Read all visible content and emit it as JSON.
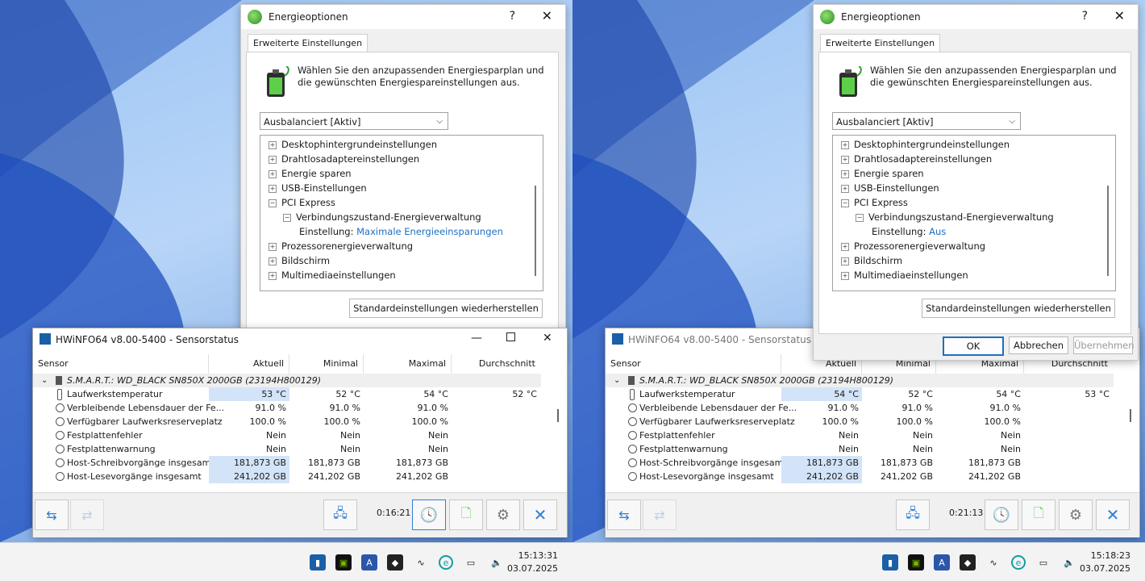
{
  "panels": [
    {
      "energy": {
        "title": "Energieoptionen",
        "help": "?",
        "close": "✕",
        "tab": "Erweiterte Einstellungen",
        "description": "Wählen Sie den anzupassenden Energiesparplan und die gewünschten Energiespareinstellungen aus.",
        "plan": "Ausbalanciert [Aktiv]",
        "tree": [
          "Desktophintergrundeinstellungen",
          "Drahtlosadaptereinstellungen",
          "Energie sparen",
          "USB-Einstellungen",
          "PCI Express",
          "Verbindungszustand-Energieverwaltung",
          "Einstellung:",
          "Prozessorenergieverwaltung",
          "Bildschirm",
          "Multimediaeinstellungen"
        ],
        "setting_value": "Maximale Energieeinsparungen",
        "restore": "Standardeinstellungen wiederherstellen",
        "ok": "",
        "cancel": "",
        "apply": ""
      },
      "hw": {
        "title": "HWiNFO64 v8.00-5400 - Sensorstatus",
        "columns": [
          "Sensor",
          "Aktuell",
          "Minimal",
          "Maximal",
          "Durchschnitt"
        ],
        "device": "S.M.A.R.T.: WD_BLACK SN850X 2000GB (23194H800129)",
        "rows": [
          [
            "Laufwerkstemperatur",
            "53 °C",
            "52 °C",
            "54 °C",
            "52 °C"
          ],
          [
            "Verbleibende Lebensdauer der Fe...",
            "91.0 %",
            "91.0 %",
            "91.0 %",
            ""
          ],
          [
            "Verfügbarer Laufwerksreserveplatz",
            "100.0 %",
            "100.0 %",
            "100.0 %",
            ""
          ],
          [
            "Festplattenfehler",
            "Nein",
            "Nein",
            "Nein",
            ""
          ],
          [
            "Festplattenwarnung",
            "Nein",
            "Nein",
            "Nein",
            ""
          ],
          [
            "Host-Schreibvorgänge insgesamt",
            "181,873 GB",
            "181,873 GB",
            "181,873 GB",
            ""
          ],
          [
            "Host-Lesevorgänge insgesamt",
            "241,202 GB",
            "241,202 GB",
            "241,202 GB",
            ""
          ]
        ],
        "timer": "0:16:21"
      },
      "clock": {
        "time": "15:13:31",
        "date": "03.07.2025"
      }
    },
    {
      "energy": {
        "title": "Energieoptionen",
        "help": "?",
        "close": "✕",
        "tab": "Erweiterte Einstellungen",
        "description": "Wählen Sie den anzupassenden Energiesparplan und die gewünschten Energiespareinstellungen aus.",
        "plan": "Ausbalanciert [Aktiv]",
        "tree": [
          "Desktophintergrundeinstellungen",
          "Drahtlosadaptereinstellungen",
          "Energie sparen",
          "USB-Einstellungen",
          "PCI Express",
          "Verbindungszustand-Energieverwaltung",
          "Einstellung:",
          "Prozessorenergieverwaltung",
          "Bildschirm",
          "Multimediaeinstellungen"
        ],
        "setting_value": "Aus",
        "restore": "Standardeinstellungen wiederherstellen",
        "ok": "OK",
        "cancel": "Abbrechen",
        "apply": "Übernehmen"
      },
      "hw": {
        "title": "HWiNFO64 v8.00-5400 - Sensorstatus",
        "columns": [
          "Sensor",
          "Aktuell",
          "Minimal",
          "Maximal",
          "Durchschnitt"
        ],
        "device": "S.M.A.R.T.: WD_BLACK SN850X 2000GB (23194H800129)",
        "rows": [
          [
            "Laufwerkstemperatur",
            "54 °C",
            "52 °C",
            "54 °C",
            "53 °C"
          ],
          [
            "Verbleibende Lebensdauer der Fe...",
            "91.0 %",
            "91.0 %",
            "91.0 %",
            ""
          ],
          [
            "Verfügbarer Laufwerksreserveplatz",
            "100.0 %",
            "100.0 %",
            "100.0 %",
            ""
          ],
          [
            "Festplattenfehler",
            "Nein",
            "Nein",
            "Nein",
            ""
          ],
          [
            "Festplattenwarnung",
            "Nein",
            "Nein",
            "Nein",
            ""
          ],
          [
            "Host-Schreibvorgänge insgesamt",
            "181,873 GB",
            "181,873 GB",
            "181,873 GB",
            ""
          ],
          [
            "Host-Lesevorgänge insgesamt",
            "241,202 GB",
            "241,202 GB",
            "241,202 GB",
            ""
          ]
        ],
        "timer": "0:21:13"
      },
      "clock": {
        "time": "15:18:23",
        "date": "03.07.2025"
      }
    }
  ]
}
